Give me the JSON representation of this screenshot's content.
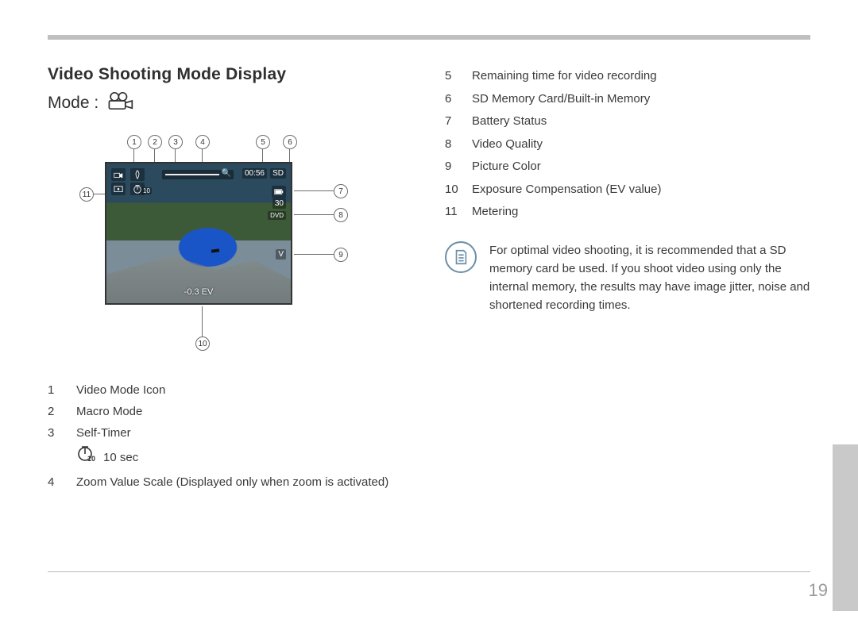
{
  "page_number": "19",
  "heading": "Video Shooting Mode Display",
  "mode_label": "Mode :",
  "lcd": {
    "rec_time": "00:56",
    "sd_label": "SD",
    "ev_text": "-0.3 EV",
    "quality_label": "30",
    "format_label": "DVD",
    "color_label": "V",
    "timer_label": "10"
  },
  "callouts": [
    "1",
    "2",
    "3",
    "4",
    "5",
    "6",
    "7",
    "8",
    "9",
    "10",
    "11"
  ],
  "legend_left": [
    {
      "n": "1",
      "t": "Video Mode Icon"
    },
    {
      "n": "2",
      "t": "Macro Mode"
    },
    {
      "n": "3",
      "t": "Self-Timer"
    }
  ],
  "legend_left_sub": {
    "t": "10 sec"
  },
  "legend_left_4": {
    "n": "4",
    "t": "Zoom Value Scale (Displayed only when zoom is activated)"
  },
  "legend_right": [
    {
      "n": "5",
      "t": "Remaining time for video recording"
    },
    {
      "n": "6",
      "t": "SD Memory Card/Built-in Memory"
    },
    {
      "n": "7",
      "t": "Battery Status"
    },
    {
      "n": "8",
      "t": "Video Quality"
    },
    {
      "n": "9",
      "t": "Picture Color"
    },
    {
      "n": "10",
      "t": "Exposure Compensation (EV value)"
    },
    {
      "n": "11",
      "t": "Metering"
    }
  ],
  "note_text": "For optimal video shooting, it is recommended that a SD memory card be used. If you shoot video using only the internal memory, the results may have image jitter, noise and shortened recording times."
}
